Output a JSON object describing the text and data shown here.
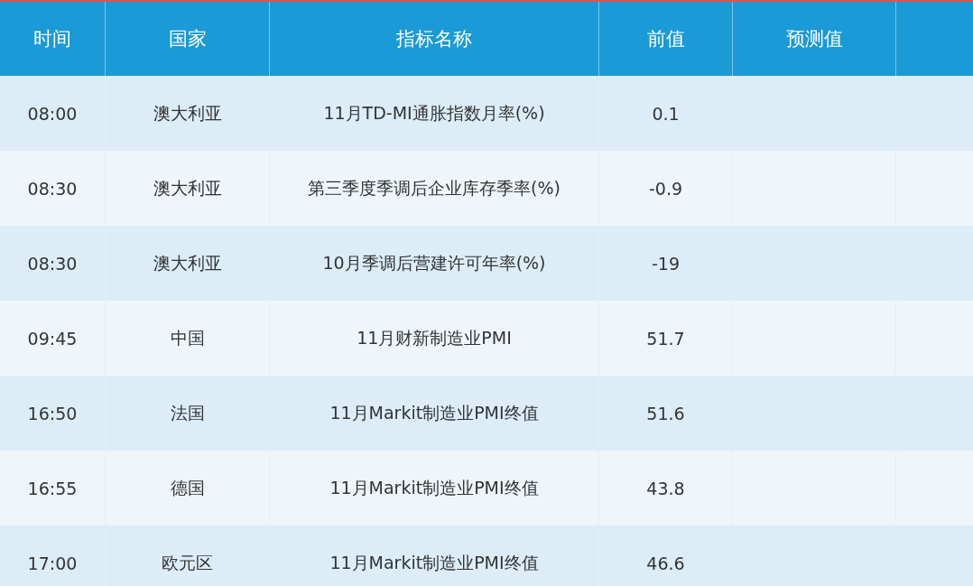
{
  "table": {
    "columns": [
      "时间",
      "国家",
      "指标名称",
      "前值",
      "预测值"
    ],
    "rows": [
      {
        "time": "08:00",
        "country": "澳大利亚",
        "indicator": "11月TD-MI通胀指数月率(%)",
        "previous": "0.1"
      },
      {
        "time": "08:30",
        "country": "澳大利亚",
        "indicator": "第三季度季调后企业库存季率(%)",
        "previous": "-0.9"
      },
      {
        "time": "08:30",
        "country": "澳大利亚",
        "indicator": "10月季调后营建许可年率(%)",
        "previous": "-19"
      },
      {
        "time": "09:45",
        "country": "中国",
        "indicator": "11月财新制造业PMI",
        "previous": "51.7"
      },
      {
        "time": "16:50",
        "country": "法国",
        "indicator": "11月Markit制造业PMI终值",
        "previous": "51.6"
      },
      {
        "time": "16:55",
        "country": "德国",
        "indicator": "11月Markit制造业PMI终值",
        "previous": "43.8"
      },
      {
        "time": "17:00",
        "country": "欧元区",
        "indicator": "11月Markit制造业PMI终值",
        "previous": "46.6"
      }
    ]
  }
}
